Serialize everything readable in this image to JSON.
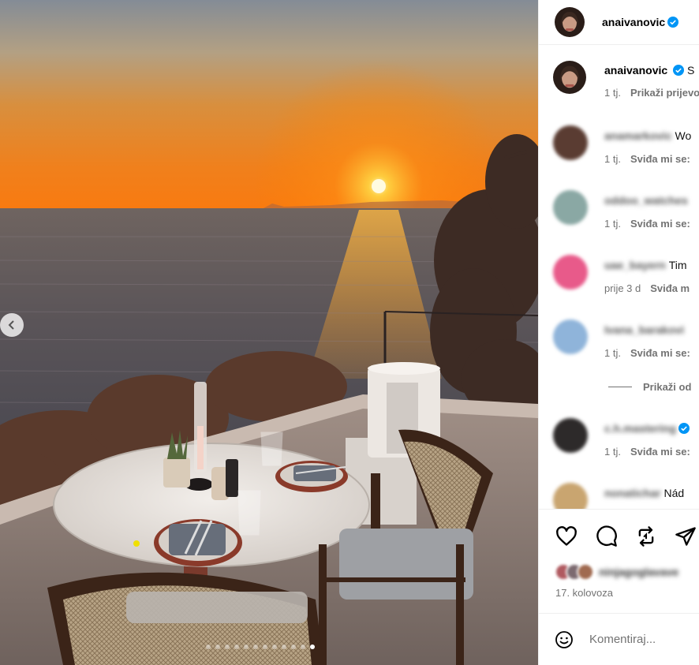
{
  "post": {
    "author": "anaivanovic",
    "verified": true,
    "caption_start": "S",
    "caption_time": "1 tj.",
    "see_translation": "Prikaži prijevod"
  },
  "carousel": {
    "prev_icon": "chevron-left-icon",
    "dot_count": 12,
    "active_index": 11
  },
  "comments": [
    {
      "username": "anamarkovic",
      "text": "Wo",
      "time": "1 tj.",
      "like_label": "Sviđa mi se:",
      "avatar_color": "#5a3c32",
      "verified": false
    },
    {
      "username": "oddoo_watches",
      "text": "",
      "time": "1 tj.",
      "like_label": "Sviđa mi se:",
      "avatar_color": "#8aa8a4",
      "verified": false
    },
    {
      "username": "uae_bayern",
      "text": "Tim",
      "time": "prije 3 d",
      "like_label": "Sviđa m",
      "avatar_color": "#e85a8a",
      "verified": false
    },
    {
      "username": "Ivana_barakovi",
      "text": "",
      "time": "1 tj.",
      "like_label": "Sviđa mi se:",
      "avatar_color": "#8fb4da",
      "verified": false
    },
    {
      "username": "c.h.mastering",
      "text": "",
      "time": "1 tj.",
      "like_label": "Sviđa mi se:",
      "avatar_color": "#2d2a2a",
      "verified": true
    },
    {
      "username": "nonatichar",
      "text": "Nád",
      "time": "",
      "like_label": "",
      "avatar_color": "#c9a570",
      "verified": false
    }
  ],
  "view_replies": "Prikaži od",
  "actions": {
    "like_icon": "heart-icon",
    "comment_icon": "comment-icon",
    "repost_icon": "repost-icon",
    "share_icon": "share-icon",
    "likes_by": "ninjagoglavave",
    "date": "17. kolovoza"
  },
  "add_comment": {
    "emoji_icon": "emoji-icon",
    "placeholder": "Komentiraj..."
  },
  "colors": {
    "verified_blue": "#0095f6",
    "muted_text": "#737373",
    "divider": "#efefef"
  }
}
